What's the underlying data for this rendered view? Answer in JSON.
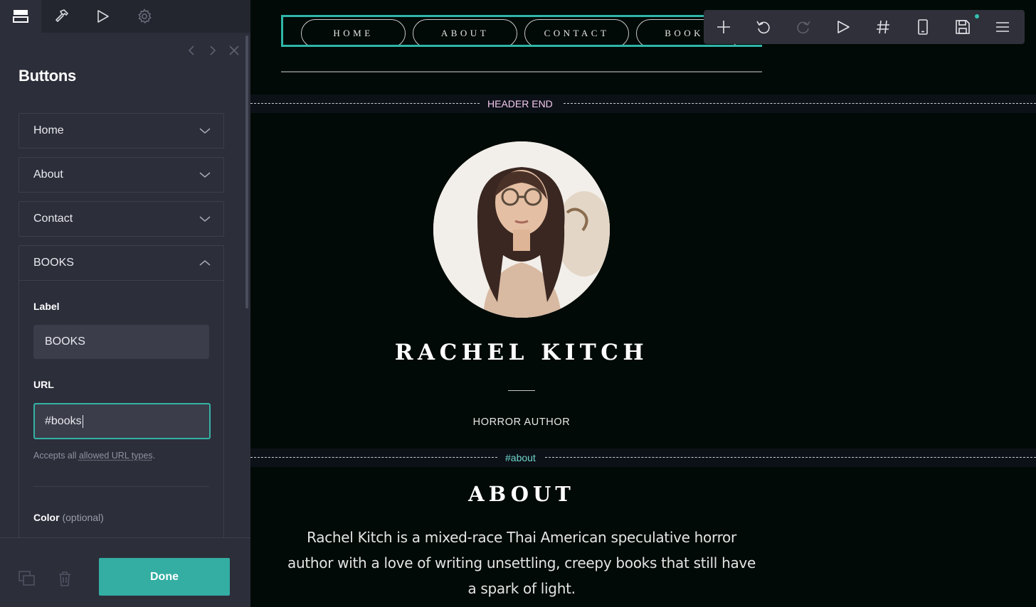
{
  "panel": {
    "title": "Buttons",
    "tabs": [
      "layout-icon",
      "hammer-icon",
      "play-icon",
      "gear-icon"
    ],
    "accordion": [
      {
        "label": "Home",
        "expanded": false
      },
      {
        "label": "About",
        "expanded": false
      },
      {
        "label": "Contact",
        "expanded": false
      },
      {
        "label": "BOOKS",
        "expanded": true
      }
    ],
    "editor": {
      "label_field_label": "Label",
      "label_value": "BOOKS",
      "url_field_label": "URL",
      "url_value": "#books",
      "help_prefix": "Accepts all ",
      "help_link": "allowed URL types",
      "help_suffix": ".",
      "color_label": "Color",
      "color_optional": "(optional)"
    },
    "footer": {
      "done_label": "Done"
    },
    "accent": "#34aea3"
  },
  "canvas": {
    "nav": [
      "HOME",
      "ABOUT",
      "CONTACT",
      "BOOKS"
    ],
    "markers": {
      "header_end": "HEADER END",
      "about_anchor": "#about"
    },
    "hero": {
      "name": "RACHEL KITCH",
      "subtitle": "HORROR AUTHOR"
    },
    "about": {
      "title": "ABOUT",
      "text": "Rachel Kitch is a mixed-race Thai American speculative horror author with a love of writing unsettling, creepy books that still have a spark of light."
    }
  },
  "toolbar": {
    "icons": [
      "plus-icon",
      "undo-icon",
      "redo-icon",
      "play-icon",
      "hash-icon",
      "mobile-icon",
      "save-icon",
      "menu-icon"
    ]
  }
}
